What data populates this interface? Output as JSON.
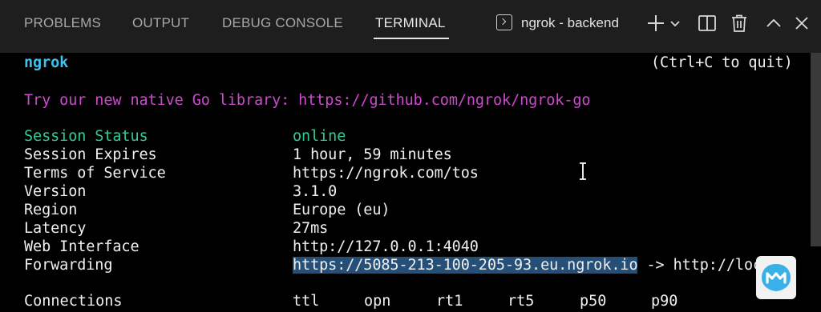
{
  "panel": {
    "tabs": [
      {
        "label": "PROBLEMS"
      },
      {
        "label": "OUTPUT"
      },
      {
        "label": "DEBUG CONSOLE"
      },
      {
        "label": "TERMINAL"
      }
    ],
    "active_tab": "TERMINAL",
    "terminal_name": "ngrok - backend",
    "icons": [
      "terminal-icon",
      "plus-icon",
      "chevron-down-icon",
      "split-icon",
      "trash-icon",
      "chevron-up-icon",
      "close-icon"
    ]
  },
  "terminal": {
    "title": "ngrok",
    "quit_hint": "(Ctrl+C to quit)",
    "promo": "Try our new native Go library: https://github.com/ngrok/ngrok-go",
    "status_rows": [
      {
        "label": "Session Status",
        "value": "online"
      },
      {
        "label": "Session Expires",
        "value": "1 hour, 59 minutes"
      },
      {
        "label": "Terms of Service",
        "value": "https://ngrok.com/tos"
      },
      {
        "label": "Version",
        "value": "3.1.0"
      },
      {
        "label": "Region",
        "value": "Europe (eu)"
      },
      {
        "label": "Latency",
        "value": "27ms"
      },
      {
        "label": "Web Interface",
        "value": "http://127.0.0.1:4040"
      }
    ],
    "forwarding": {
      "label": "Forwarding",
      "url": "https://5085-213-100-205-93.eu.ngrok.io",
      "rest": " -> http://localh"
    },
    "connections": {
      "label": "Connections",
      "columns": [
        "ttl",
        "opn",
        "rt1",
        "rt5",
        "p50",
        "p90"
      ]
    }
  },
  "colors": {
    "title": "#3fc1ec",
    "promo": "#cf49cf",
    "online": "#34c99c",
    "selection": "#264f78"
  }
}
